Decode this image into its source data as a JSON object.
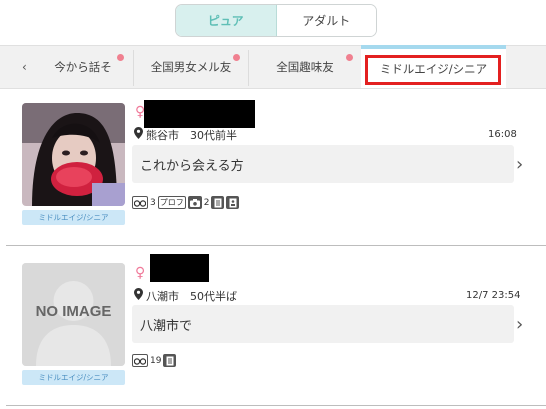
{
  "toggle": {
    "pure": "ピュア",
    "adult": "アダルト"
  },
  "tabs": [
    {
      "label": "今から話そ",
      "dot": true
    },
    {
      "label": "全国男女メル友",
      "dot": true
    },
    {
      "label": "全国趣味友",
      "dot": true
    },
    {
      "label": "ミドルエイジ/シニア",
      "dot": false,
      "active": true
    }
  ],
  "tab_prev_icon": "‹",
  "posts": [
    {
      "gender_icon": "♀",
      "location": "熊谷市",
      "age": "30代前半",
      "time": "16:08",
      "message": "これから会える方",
      "badge": "ミドルエイジ/シニア",
      "views_icon": "binoculars-icon",
      "views": "3",
      "profile_label": "プロフ",
      "photos": "2",
      "accent_color": "#f07a9a"
    },
    {
      "gender_icon": "♀",
      "location": "八潮市",
      "age": "50代半ば",
      "time": "12/7 23:54",
      "message": "八潮市で",
      "badge": "ミドルエイジ/シニア",
      "views_icon": "binoculars-icon",
      "views": "19",
      "no_image_label": "NO IMAGE",
      "accent_color": "#f07a9a"
    }
  ]
}
